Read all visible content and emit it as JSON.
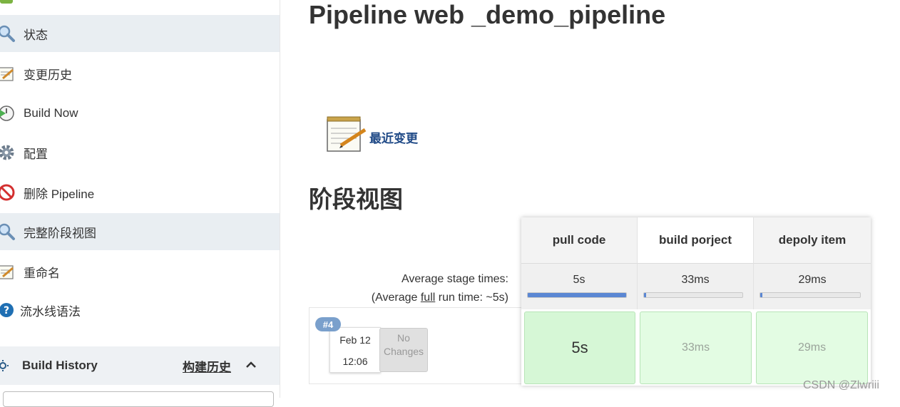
{
  "sidebar": {
    "items": [
      {
        "label": "状态",
        "icon": "search-icon"
      },
      {
        "label": "变更历史",
        "icon": "notepad-icon"
      },
      {
        "label": "Build Now",
        "icon": "build-clock-icon"
      },
      {
        "label": "配置",
        "icon": "gear-icon"
      },
      {
        "label": "删除 Pipeline",
        "icon": "no-entry-icon"
      },
      {
        "label": "完整阶段视图",
        "icon": "search-icon"
      },
      {
        "label": "重命名",
        "icon": "notepad-icon"
      },
      {
        "label": "流水线语法",
        "icon": "help-icon"
      }
    ],
    "build_history": {
      "title": "Build History",
      "title_cn": "构建历史"
    }
  },
  "main": {
    "title": "Pipeline web _demo_pipeline",
    "recent_changes": "最近变更",
    "stage_view_title": "阶段视图"
  },
  "stage_view": {
    "stages": [
      {
        "name": "pull code",
        "avg": "5s",
        "avg_fraction": 1.0,
        "run": "5s"
      },
      {
        "name": "build porject",
        "avg": "33ms",
        "avg_fraction": 0.02,
        "run": "33ms"
      },
      {
        "name": "depoly item",
        "avg": "29ms",
        "avg_fraction": 0.02,
        "run": "29ms"
      }
    ],
    "avg_stage_label": "Average stage times:",
    "avg_run_prefix": "(Average ",
    "avg_run_link": "full",
    "avg_run_suffix": " run time: ~5s)",
    "run": {
      "badge": "#4",
      "date": "Feb 12",
      "time": "12:06",
      "changes_line1": "No",
      "changes_line2": "Changes"
    }
  },
  "watermark": "CSDN @Zlwriii",
  "colors": {
    "link": "#204a87",
    "success": "#d6f7d6",
    "progress": "#5b87d3",
    "badge": "#7aa0cc"
  }
}
